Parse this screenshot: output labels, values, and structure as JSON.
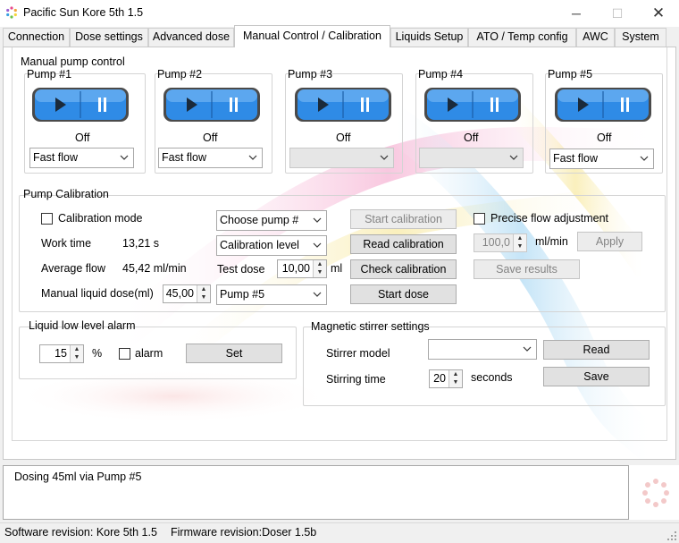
{
  "window": {
    "title": "Pacific Sun Kore 5th 1.5",
    "minimize": "─",
    "maximize": "☐",
    "close": "✕"
  },
  "tabs": [
    {
      "label": "Connection"
    },
    {
      "label": "Dose settings"
    },
    {
      "label": "Advanced dose"
    },
    {
      "label": "Manual Control / Calibration",
      "active": true
    },
    {
      "label": "Liquids Setup"
    },
    {
      "label": "ATO / Temp config"
    },
    {
      "label": "AWC"
    },
    {
      "label": "System"
    }
  ],
  "manual_pump_control": {
    "title": "Manual pump control",
    "pumps": [
      {
        "label": "Pump #1",
        "state": "Off",
        "mode": "Fast flow"
      },
      {
        "label": "Pump #2",
        "state": "Off",
        "mode": "Fast flow"
      },
      {
        "label": "Pump #3",
        "state": "Off",
        "mode": ""
      },
      {
        "label": "Pump #4",
        "state": "Off",
        "mode": ""
      },
      {
        "label": "Pump #5",
        "state": "Off",
        "mode": "Fast flow"
      }
    ]
  },
  "calibration": {
    "title": "Pump Calibration",
    "calibration_mode_label": "Calibration mode",
    "work_time_label": "Work time",
    "work_time_value": "13,21 s",
    "average_flow_label": "Average flow",
    "average_flow_value": "45,42 ml/min",
    "manual_dose_label": "Manual liquid dose(ml)",
    "manual_dose_value": "45,00",
    "choose_pump": "Choose pump #",
    "calibration_level": "Calibration level",
    "test_dose_label": "Test dose",
    "test_dose_value": "10,00",
    "test_dose_unit": "ml",
    "dose_pump": "Pump #5",
    "start_calibration": "Start calibration",
    "read_calibration": "Read calibration",
    "check_calibration": "Check calibration",
    "start_dose": "Start dose",
    "precise_flow_label": "Precise flow adjustment",
    "precise_flow_value": "100,0",
    "precise_flow_unit": "ml/min",
    "apply": "Apply",
    "save_results": "Save results"
  },
  "liquid_alarm": {
    "title": "Liquid low level alarm",
    "percent_value": "15",
    "percent_unit": "%",
    "alarm_label": "alarm",
    "set_button": "Set"
  },
  "stirrer": {
    "title": "Magnetic stirrer settings",
    "model_label": "Stirrer model",
    "model_value": "",
    "stirring_time_label": "Stirring time",
    "stirring_time_value": "20",
    "stirring_time_unit": "seconds",
    "read_button": "Read",
    "save_button": "Save"
  },
  "log": {
    "message": "Dosing 45ml via Pump #5"
  },
  "status": {
    "software": "Software revision: Kore 5th 1.5",
    "firmware": "Firmware revision:Doser 1.5b"
  },
  "colors": {
    "pump_button": "#2f8be6",
    "pump_button_dark": "#1c5fa8",
    "window_bg": "#f0f0f0"
  }
}
